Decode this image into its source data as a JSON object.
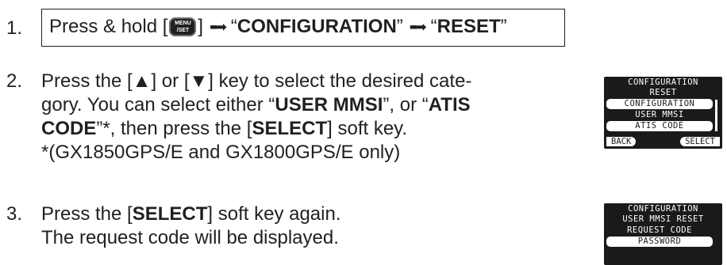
{
  "steps": [
    {
      "number": "1.",
      "text_prefix": "Press & hold [",
      "key_icon": "menu-set-key",
      "key_label_line1": "MENU",
      "key_label_line2": "/SET",
      "text_after_key": "]",
      "quote_open_1": "“",
      "strong_1": "CONFIGURATION",
      "quote_close_1": "”",
      "quote_open_2": "“",
      "strong_2": "RESET",
      "quote_close_2": "”"
    },
    {
      "number": "2.",
      "line1": "Press the [▲] or [▼] key to select the desired cate-",
      "line2_a": "gory. You can select either “",
      "line2_b": "USER MMSI",
      "line2_c": "”, or “",
      "line2_d": "ATIS",
      "line3_a": "CODE",
      "line3_b": "”*, then press the [",
      "line3_c": "SELECT",
      "line3_d": "] soft key.",
      "line4": "*(GX1850GPS/E and GX1800GPS/E only)"
    },
    {
      "number": "3.",
      "line1_a": "Press the [",
      "line1_b": "SELECT",
      "line1_c": "] soft key again.",
      "line2": "The request code will be displayed."
    }
  ],
  "screen1": {
    "rows": [
      "CONFIGURATION",
      "RESET",
      "CONFIGURATION",
      "USER MMSI",
      "ATIS CODE"
    ],
    "softkey_left": "BACK",
    "softkey_right": "SELECT"
  },
  "screen2": {
    "rows": [
      "CONFIGURATION",
      "USER MMSI RESET",
      "REQUEST CODE",
      "PASSWORD"
    ]
  }
}
